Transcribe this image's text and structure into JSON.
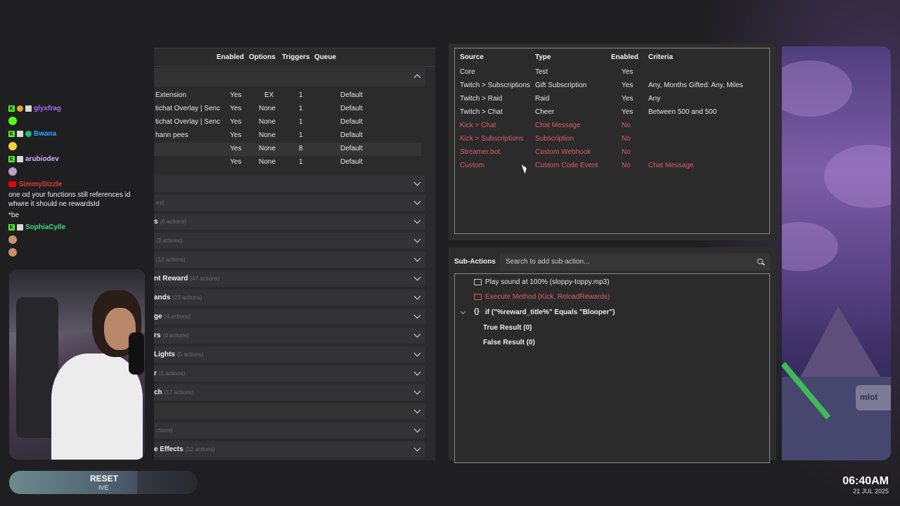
{
  "chat": {
    "users": [
      "glyxfrag",
      "Bwana",
      "arubiodev",
      "SimmyDizzle",
      "SophiaCylle"
    ],
    "message_1": "one od your functions still references id",
    "message_2": "whwre it should ne rewardsId",
    "message_3": "*be"
  },
  "actions": {
    "columns": [
      "Enabled",
      "Options",
      "Triggers",
      "Queue"
    ],
    "rows": [
      {
        "name": "Extension",
        "enabled": "Yes",
        "options": "EX",
        "triggers": "1",
        "queue": "Default"
      },
      {
        "name": "tichat Overlay | Senc",
        "enabled": "Yes",
        "options": "None",
        "triggers": "1",
        "queue": "Default"
      },
      {
        "name": "tichat Overlay | Senc",
        "enabled": "Yes",
        "options": "None",
        "triggers": "1",
        "queue": "Default"
      },
      {
        "name": "hann pees",
        "enabled": "Yes",
        "options": "None",
        "triggers": "1",
        "queue": "Default"
      },
      {
        "name": "",
        "enabled": "Yes",
        "options": "None",
        "triggers": "8",
        "queue": "Default"
      },
      {
        "name": "",
        "enabled": "Yes",
        "options": "None",
        "triggers": "1",
        "queue": "Default"
      }
    ],
    "groups": [
      {
        "name": "",
        "count": ""
      },
      {
        "name": "",
        "count": "es)"
      },
      {
        "name": "s",
        "count": "(6 actions)"
      },
      {
        "name": "",
        "count": "(3 actions)"
      },
      {
        "name": "",
        "count": "(12 actions)"
      },
      {
        "name": "nt Reward",
        "count": "(47 actions)"
      },
      {
        "name": "ands",
        "count": "(23 actions)"
      },
      {
        "name": "ge",
        "count": "(4 actions)"
      },
      {
        "name": "rs",
        "count": "(4 actions)"
      },
      {
        "name": "Lights",
        "count": "(5 actions)"
      },
      {
        "name": "r",
        "count": "(1 actions)"
      },
      {
        "name": "ch",
        "count": "(17 actions)"
      },
      {
        "name": "",
        "count": ""
      },
      {
        "name": "",
        "count": "ctions)"
      },
      {
        "name": "e Effects",
        "count": "(12 actions)"
      }
    ]
  },
  "triggers": {
    "columns": [
      "Source",
      "Type",
      "Enabled",
      "Criteria"
    ],
    "rows": [
      {
        "source": "Core",
        "type": "Test",
        "enabled": "Yes",
        "criteria": "",
        "on": true
      },
      {
        "source": "Twitch > Subscriptions",
        "type": "Gift Subscription",
        "enabled": "Yes",
        "criteria": "Any, Months Gifted: Any, Miles",
        "on": true
      },
      {
        "source": "Twitch > Raid",
        "type": "Raid",
        "enabled": "Yes",
        "criteria": "Any",
        "on": true
      },
      {
        "source": "Twitch > Chat",
        "type": "Cheer",
        "enabled": "Yes",
        "criteria": "Between 500 and 500",
        "on": true
      },
      {
        "source": "Kick > Chat",
        "type": "Chat Message",
        "enabled": "No",
        "criteria": "",
        "on": false
      },
      {
        "source": "Kick > Subscriptions",
        "type": "Subscription",
        "enabled": "No",
        "criteria": "",
        "on": false
      },
      {
        "source": "Streamer.bot",
        "type": "Custom Webhook",
        "enabled": "No",
        "criteria": "",
        "on": false
      },
      {
        "source": "Custom",
        "type": "Custom Code Event",
        "enabled": "No",
        "criteria": "Chat Message",
        "on": false
      }
    ]
  },
  "sub_actions": {
    "title": "Sub-Actions",
    "search_placeholder": "Search to add sub-action...",
    "items": [
      "Play sound at 100% (sloppy-toppy.mp3)",
      "Execute Method (Kick, ReloadRewards)",
      "if (\"%reward_title%\" Equals \"Blooper\")",
      "True Result (0)",
      "False Result (0)"
    ],
    "brace": "{}"
  },
  "game": {
    "sign_text": "mlot"
  },
  "bottom": {
    "reset_label": "RESET",
    "reset_sub": "IVE",
    "time": "06:40AM",
    "date": "21 JUL 2025"
  },
  "colors": {
    "disabled_red": "#e05a6e",
    "kick_green": "#53fc18"
  },
  "icons": [
    "chevron-up-icon",
    "chevron-down-icon",
    "search-icon",
    "sound-icon",
    "method-icon",
    "kick-badge-icon",
    "youtube-icon"
  ]
}
